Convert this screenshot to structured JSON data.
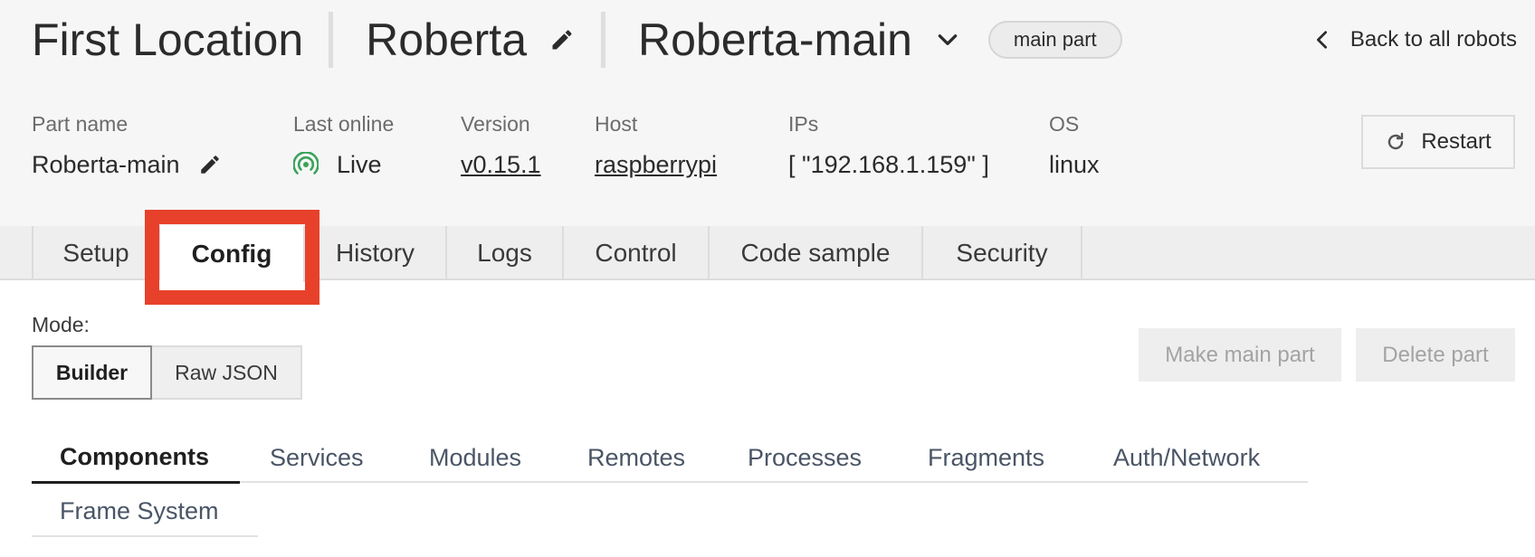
{
  "header": {
    "location": "First Location",
    "robot": "Roberta",
    "part": "Roberta-main",
    "badge": "main part",
    "back_label": "Back to all robots"
  },
  "meta": {
    "part_name_label": "Part name",
    "part_name_value": "Roberta-main",
    "last_online_label": "Last online",
    "last_online_value": "Live",
    "version_label": "Version",
    "version_value": "v0.15.1",
    "host_label": "Host",
    "host_value": "raspberrypi",
    "ips_label": "IPs",
    "ips_value": "[ \"192.168.1.159\" ]",
    "os_label": "OS",
    "os_value": "linux"
  },
  "restart_label": "Restart",
  "tabs": [
    {
      "label": "Setup"
    },
    {
      "label": "Config"
    },
    {
      "label": "History"
    },
    {
      "label": "Logs"
    },
    {
      "label": "Control"
    },
    {
      "label": "Code sample"
    },
    {
      "label": "Security"
    }
  ],
  "active_tab": "Config",
  "mode": {
    "label": "Mode:",
    "builder": "Builder",
    "raw_json": "Raw JSON"
  },
  "actions": {
    "make_main": "Make main part",
    "delete": "Delete part"
  },
  "sub_tabs": [
    {
      "label": "Components"
    },
    {
      "label": "Services"
    },
    {
      "label": "Modules"
    },
    {
      "label": "Remotes"
    },
    {
      "label": "Processes"
    },
    {
      "label": "Fragments"
    },
    {
      "label": "Auth/Network"
    },
    {
      "label": "Frame System"
    }
  ],
  "colors": {
    "highlight": "#e8412b",
    "live": "#3aa35a"
  }
}
